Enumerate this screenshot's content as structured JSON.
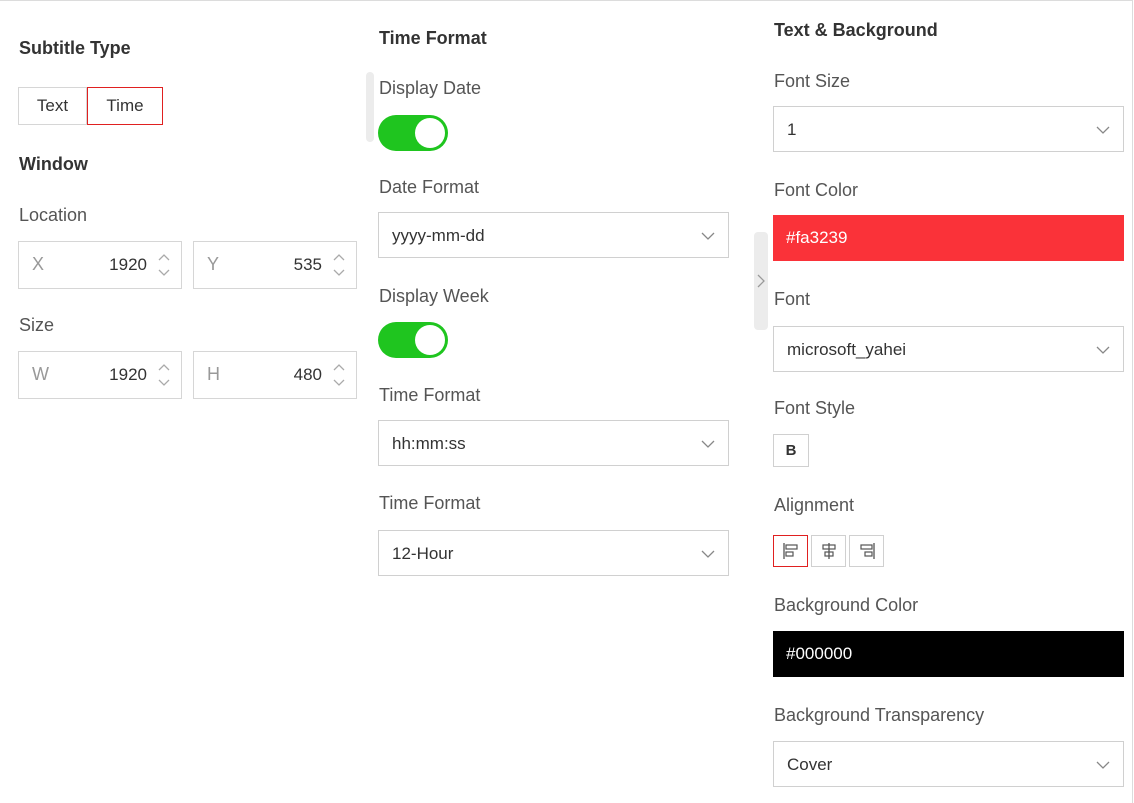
{
  "subtitle": {
    "heading": "Subtitle Type",
    "options": [
      "Text",
      "Time"
    ],
    "selected": "Time"
  },
  "window": {
    "heading": "Window",
    "location_label": "Location",
    "x_prefix": "X",
    "x_value": "1920",
    "y_prefix": "Y",
    "y_value": "535",
    "size_label": "Size",
    "w_prefix": "W",
    "w_value": "1920",
    "h_prefix": "H",
    "h_value": "480"
  },
  "time_format": {
    "heading": "Time Format",
    "display_date_label": "Display Date",
    "display_date_on": true,
    "date_format_label": "Date Format",
    "date_format_value": "yyyy-mm-dd",
    "display_week_label": "Display Week",
    "display_week_on": true,
    "time_format_label": "Time Format",
    "time_format_value": "hh:mm:ss",
    "hour_format_label": "Time Format",
    "hour_format_value": "12-Hour"
  },
  "text_bg": {
    "heading": "Text & Background",
    "font_size_label": "Font Size",
    "font_size_value": "1",
    "font_color_label": "Font Color",
    "font_color_value": "#fa3239",
    "font_label": "Font",
    "font_value": "microsoft_yahei",
    "font_style_label": "Font Style",
    "bold_label": "B",
    "alignment_label": "Alignment",
    "alignment_selected": "left",
    "bg_color_label": "Background Color",
    "bg_color_value": "#000000",
    "bg_transparency_label": "Background Transparency",
    "bg_transparency_value": "Cover"
  },
  "colors": {
    "accent_red": "#e02020",
    "toggle_green": "#1fc51f"
  }
}
